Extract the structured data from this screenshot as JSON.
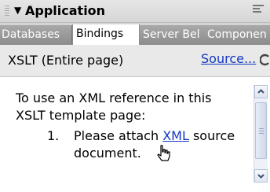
{
  "panel": {
    "title": "Application",
    "tabs": [
      {
        "label": "Databases",
        "active": false
      },
      {
        "label": "Bindings",
        "active": true
      },
      {
        "label": "Server Bel",
        "active": false
      },
      {
        "label": "Componen",
        "active": false
      }
    ]
  },
  "toolbar": {
    "document_label": "XSLT (Entire page)",
    "source_link": "Source..."
  },
  "content": {
    "intro": "To use an XML reference in this XSLT template page:",
    "steps": [
      {
        "number": "1.",
        "prefix": "Please attach ",
        "link": "XML",
        "suffix": " source document."
      }
    ]
  },
  "colors": {
    "link": "#1437c4",
    "titlebar": "#dcdcdc",
    "tab_inactive": "#9b9b9b"
  }
}
